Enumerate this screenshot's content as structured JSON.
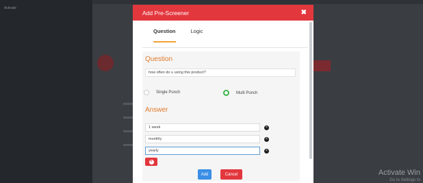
{
  "background": {
    "sidebar_text": "Activate",
    "watermark_title": "Activate Win",
    "watermark_sub": "Go to Settings to"
  },
  "modal": {
    "title": "Add Pre-Screener",
    "close_label": "✖",
    "tabs": [
      {
        "label": "Question",
        "active": true
      },
      {
        "label": "Logic",
        "active": false
      }
    ],
    "question_heading": "Question",
    "question_value": "how often do u using this product?",
    "radio_options": [
      {
        "label": "Single Punch",
        "checked": false
      },
      {
        "label": "Multi Punch",
        "checked": true
      }
    ],
    "answer_heading": "Answer",
    "answers": [
      "1 week",
      "monthly",
      "yearly"
    ],
    "add_answer_icon": "plus-circle-icon",
    "remove_answer_icon": "x-circle-icon",
    "add_label": "Add",
    "cancel_label": "Cancel"
  },
  "colors": {
    "accent_red": "#e3373e",
    "section_orange": "#e17a2b",
    "radio_green": "#3cb34a",
    "primary_blue": "#3a8ee6"
  }
}
